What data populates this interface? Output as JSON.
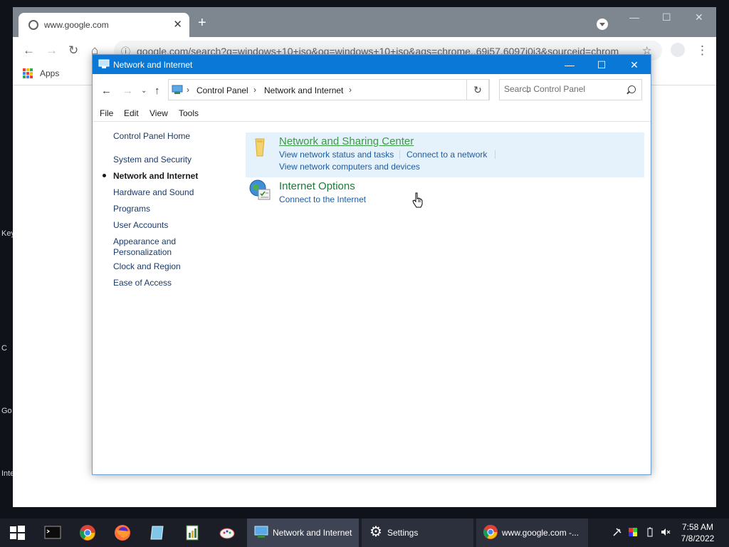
{
  "desktop": {
    "labels": [
      "Key",
      "C",
      "Go",
      "Inte"
    ]
  },
  "browser": {
    "tab_title": "www.google.com",
    "tab_close": "✕",
    "new_tab": "+",
    "address_text": "google.com/search?q=windows+10+iso&oq=windows+10+iso&aqs=chrome..69i57.6097j0j3&sourceid=chrom",
    "bookmarks_apps": "Apps",
    "window_controls": [
      "—",
      "☐",
      "✕"
    ]
  },
  "control_panel": {
    "window_title": "Network and Internet",
    "window_controls": [
      "—",
      "☐",
      "✕"
    ],
    "breadcrumb": [
      "Control Panel",
      "Network and Internet"
    ],
    "search_placeholder": "Search Control Panel",
    "menu": [
      "File",
      "Edit",
      "View",
      "Tools"
    ],
    "left_nav": {
      "home": "Control Panel Home",
      "items": [
        "System and Security",
        "Network and Internet",
        "Hardware and Sound",
        "Programs",
        "User Accounts",
        "Appearance and Personalization",
        "Clock and Region",
        "Ease of Access"
      ],
      "current": "Network and Internet"
    },
    "categories": [
      {
        "title": "Network and Sharing Center",
        "icon": "network-sharing-icon",
        "links": [
          "View network status and tasks",
          "Connect to a network",
          "View network computers and devices"
        ]
      },
      {
        "title": "Internet Options",
        "icon": "internet-options-icon",
        "links": [
          "Connect to the Internet"
        ]
      }
    ]
  },
  "taskbar": {
    "buttons": [
      {
        "label": "Network and Internet",
        "icon": "control-panel-icon",
        "active": true
      },
      {
        "label": "Settings",
        "icon": "gear-icon",
        "active": false
      },
      {
        "label": "www.google.com -...",
        "icon": "chrome-icon",
        "active": false
      }
    ],
    "time": "7:58 AM",
    "date": "7/8/2022"
  },
  "colors": {
    "titlebar": "#0a78d7",
    "category_title": "#1f7a3a",
    "link": "#1e5c9e",
    "hover_bg": "#e5f1fb"
  }
}
